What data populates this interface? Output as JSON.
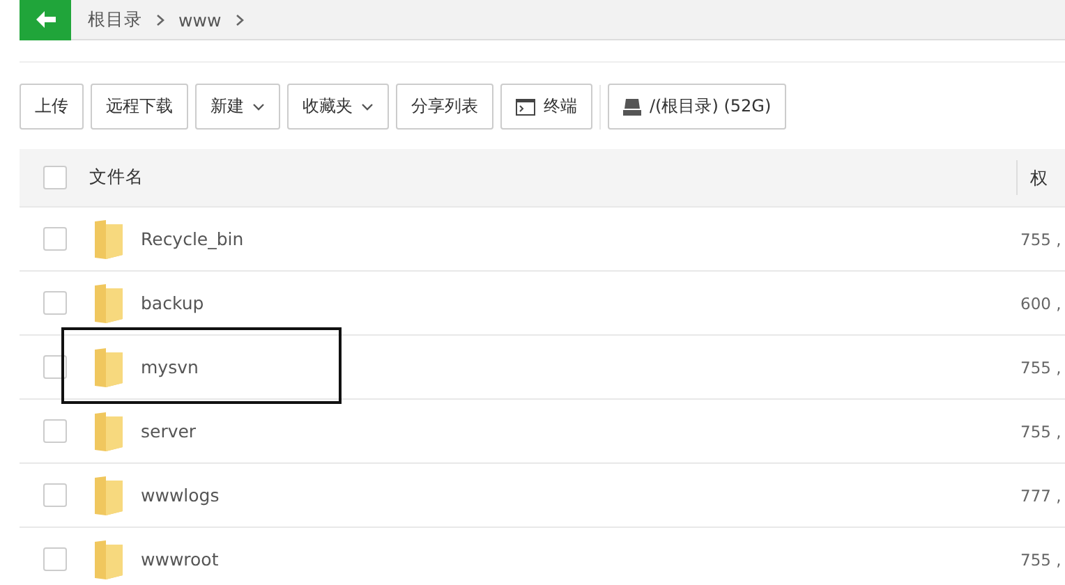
{
  "breadcrumb": {
    "items": [
      "根目录",
      "www"
    ]
  },
  "toolbar": {
    "buttons": [
      {
        "label": "上传",
        "kind": "plain"
      },
      {
        "label": "远程下载",
        "kind": "plain"
      },
      {
        "label": "新建",
        "kind": "dropdown"
      },
      {
        "label": "收藏夹",
        "kind": "dropdown"
      },
      {
        "label": "分享列表",
        "kind": "plain"
      },
      {
        "label": "终端",
        "kind": "terminal"
      },
      {
        "label": "/(根目录) (52G)",
        "kind": "disk"
      }
    ]
  },
  "table": {
    "select_all_checked": false,
    "columns": [
      "文件名",
      "权"
    ],
    "rows": [
      {
        "name": "Recycle_bin",
        "permission": "755 ,",
        "checked": false,
        "highlighted": false
      },
      {
        "name": "backup",
        "permission": "600 ,",
        "checked": false,
        "highlighted": false
      },
      {
        "name": "mysvn",
        "permission": "755 ,",
        "checked": false,
        "highlighted": true
      },
      {
        "name": "server",
        "permission": "755 ,",
        "checked": false,
        "highlighted": false
      },
      {
        "name": "wwwlogs",
        "permission": "777 ,",
        "checked": false,
        "highlighted": false
      },
      {
        "name": "wwwroot",
        "permission": "755 ,",
        "checked": false,
        "highlighted": false
      }
    ]
  }
}
